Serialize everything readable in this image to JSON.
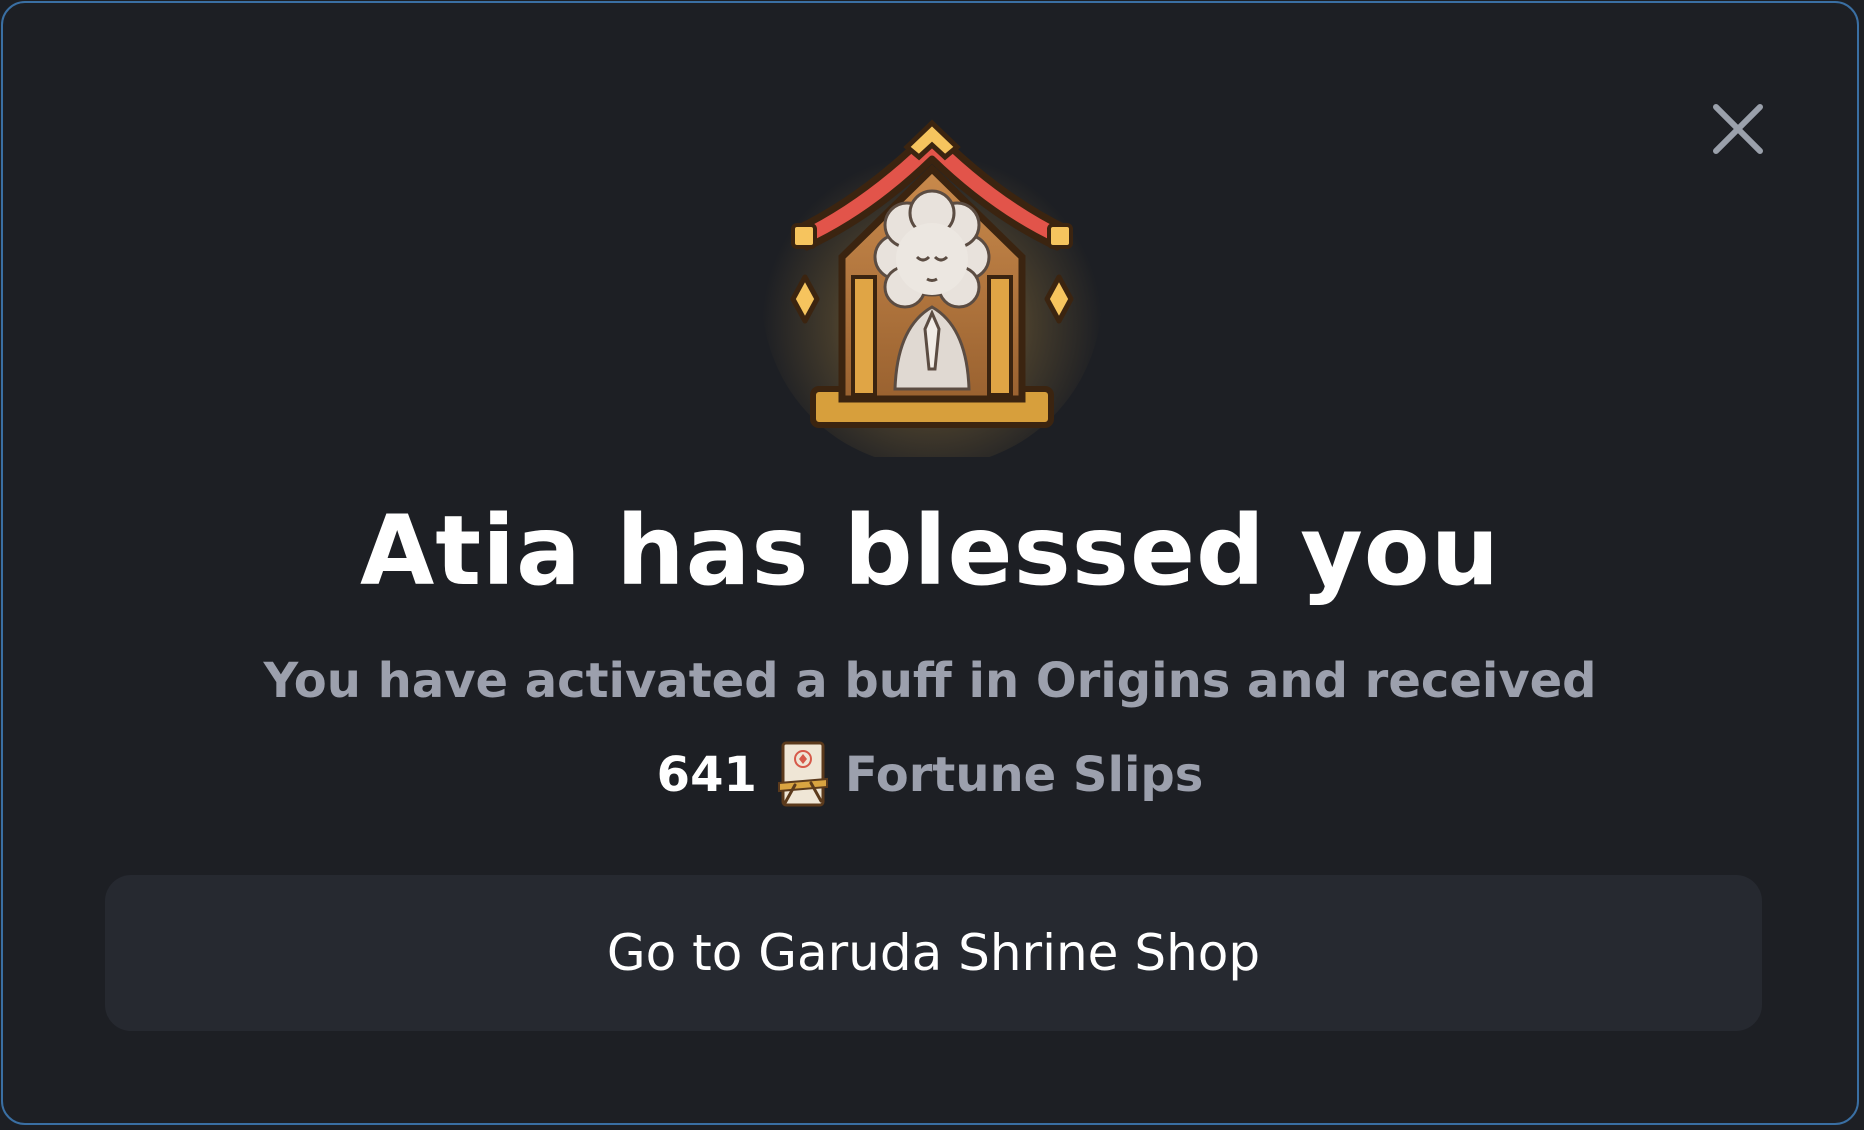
{
  "dialog": {
    "title": "Atia has blessed you",
    "subtitle": "You have activated a buff in Origins and received",
    "reward": {
      "amount": "641",
      "icon": "fortune-slip-icon",
      "label": "Fortune Slips"
    },
    "cta_label": "Go to Garuda Shrine Shop",
    "close_icon": "close-icon",
    "hero_icon": "shrine-icon"
  },
  "colors": {
    "background": "#1d1f24",
    "border": "#3a6fa3",
    "title": "#ffffff",
    "muted_text": "#9ca0ad",
    "button_bg": "#262930",
    "shrine_roof": "#e2544a",
    "shrine_wood": "#b77a3e",
    "gold": "#f2b84c"
  }
}
